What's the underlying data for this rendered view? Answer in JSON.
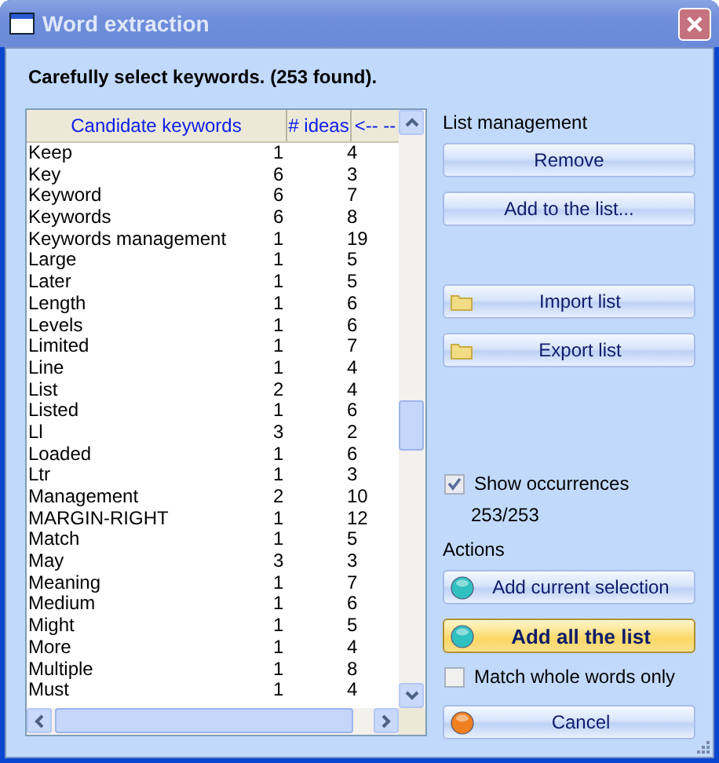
{
  "window": {
    "title": "Word extraction"
  },
  "heading": "Carefully select keywords. (253 found).",
  "table": {
    "columns": [
      "Candidate keywords",
      "# ideas",
      "<-- --"
    ],
    "rows": [
      [
        "Keep",
        "1",
        "4"
      ],
      [
        "Key",
        "6",
        "3"
      ],
      [
        "Keyword",
        "6",
        "7"
      ],
      [
        "Keywords",
        "6",
        "8"
      ],
      [
        "Keywords management",
        "1",
        "19"
      ],
      [
        "Large",
        "1",
        "5"
      ],
      [
        "Later",
        "1",
        "5"
      ],
      [
        "Length",
        "1",
        "6"
      ],
      [
        "Levels",
        "1",
        "6"
      ],
      [
        "Limited",
        "1",
        "7"
      ],
      [
        "Line",
        "1",
        "4"
      ],
      [
        "List",
        "2",
        "4"
      ],
      [
        "Listed",
        "1",
        "6"
      ],
      [
        "Ll",
        "3",
        "2"
      ],
      [
        "Loaded",
        "1",
        "6"
      ],
      [
        "Ltr",
        "1",
        "3"
      ],
      [
        "Management",
        "2",
        "10"
      ],
      [
        "MARGIN-RIGHT",
        "1",
        "12"
      ],
      [
        "Match",
        "1",
        "5"
      ],
      [
        "May",
        "3",
        "3"
      ],
      [
        "Meaning",
        "1",
        "7"
      ],
      [
        "Medium",
        "1",
        "6"
      ],
      [
        "Might",
        "1",
        "5"
      ],
      [
        "More",
        "1",
        "4"
      ],
      [
        "Multiple",
        "1",
        "8"
      ],
      [
        "Must",
        "1",
        "4"
      ]
    ]
  },
  "panel": [
    {
      "kind": "label",
      "text": "List management"
    },
    {
      "kind": "button",
      "label": "Remove",
      "default": false
    },
    {
      "kind": "button",
      "label": "Add to the list...",
      "default": false
    },
    {
      "kind": "gap"
    },
    {
      "kind": "file-button",
      "label": "Import list",
      "default": false
    },
    {
      "kind": "file-button",
      "label": "Export list",
      "default": false
    },
    {
      "kind": "gap"
    },
    {
      "kind": "checkbox",
      "label": "Show occurrences",
      "checked": true
    },
    {
      "kind": "count",
      "text": "253/253"
    },
    {
      "kind": "label",
      "text": "Actions"
    },
    {
      "kind": "action-button",
      "label": "Add current selection",
      "color": "#30c0c0",
      "default": false
    },
    {
      "kind": "action-button",
      "label": "Add all the list",
      "color": "#30c0c0",
      "default": true
    },
    {
      "kind": "checkbox",
      "label": "Match whole words only",
      "checked": false
    },
    {
      "kind": "action-button",
      "label": "Cancel",
      "color": "#f08020",
      "default": false
    }
  ]
}
